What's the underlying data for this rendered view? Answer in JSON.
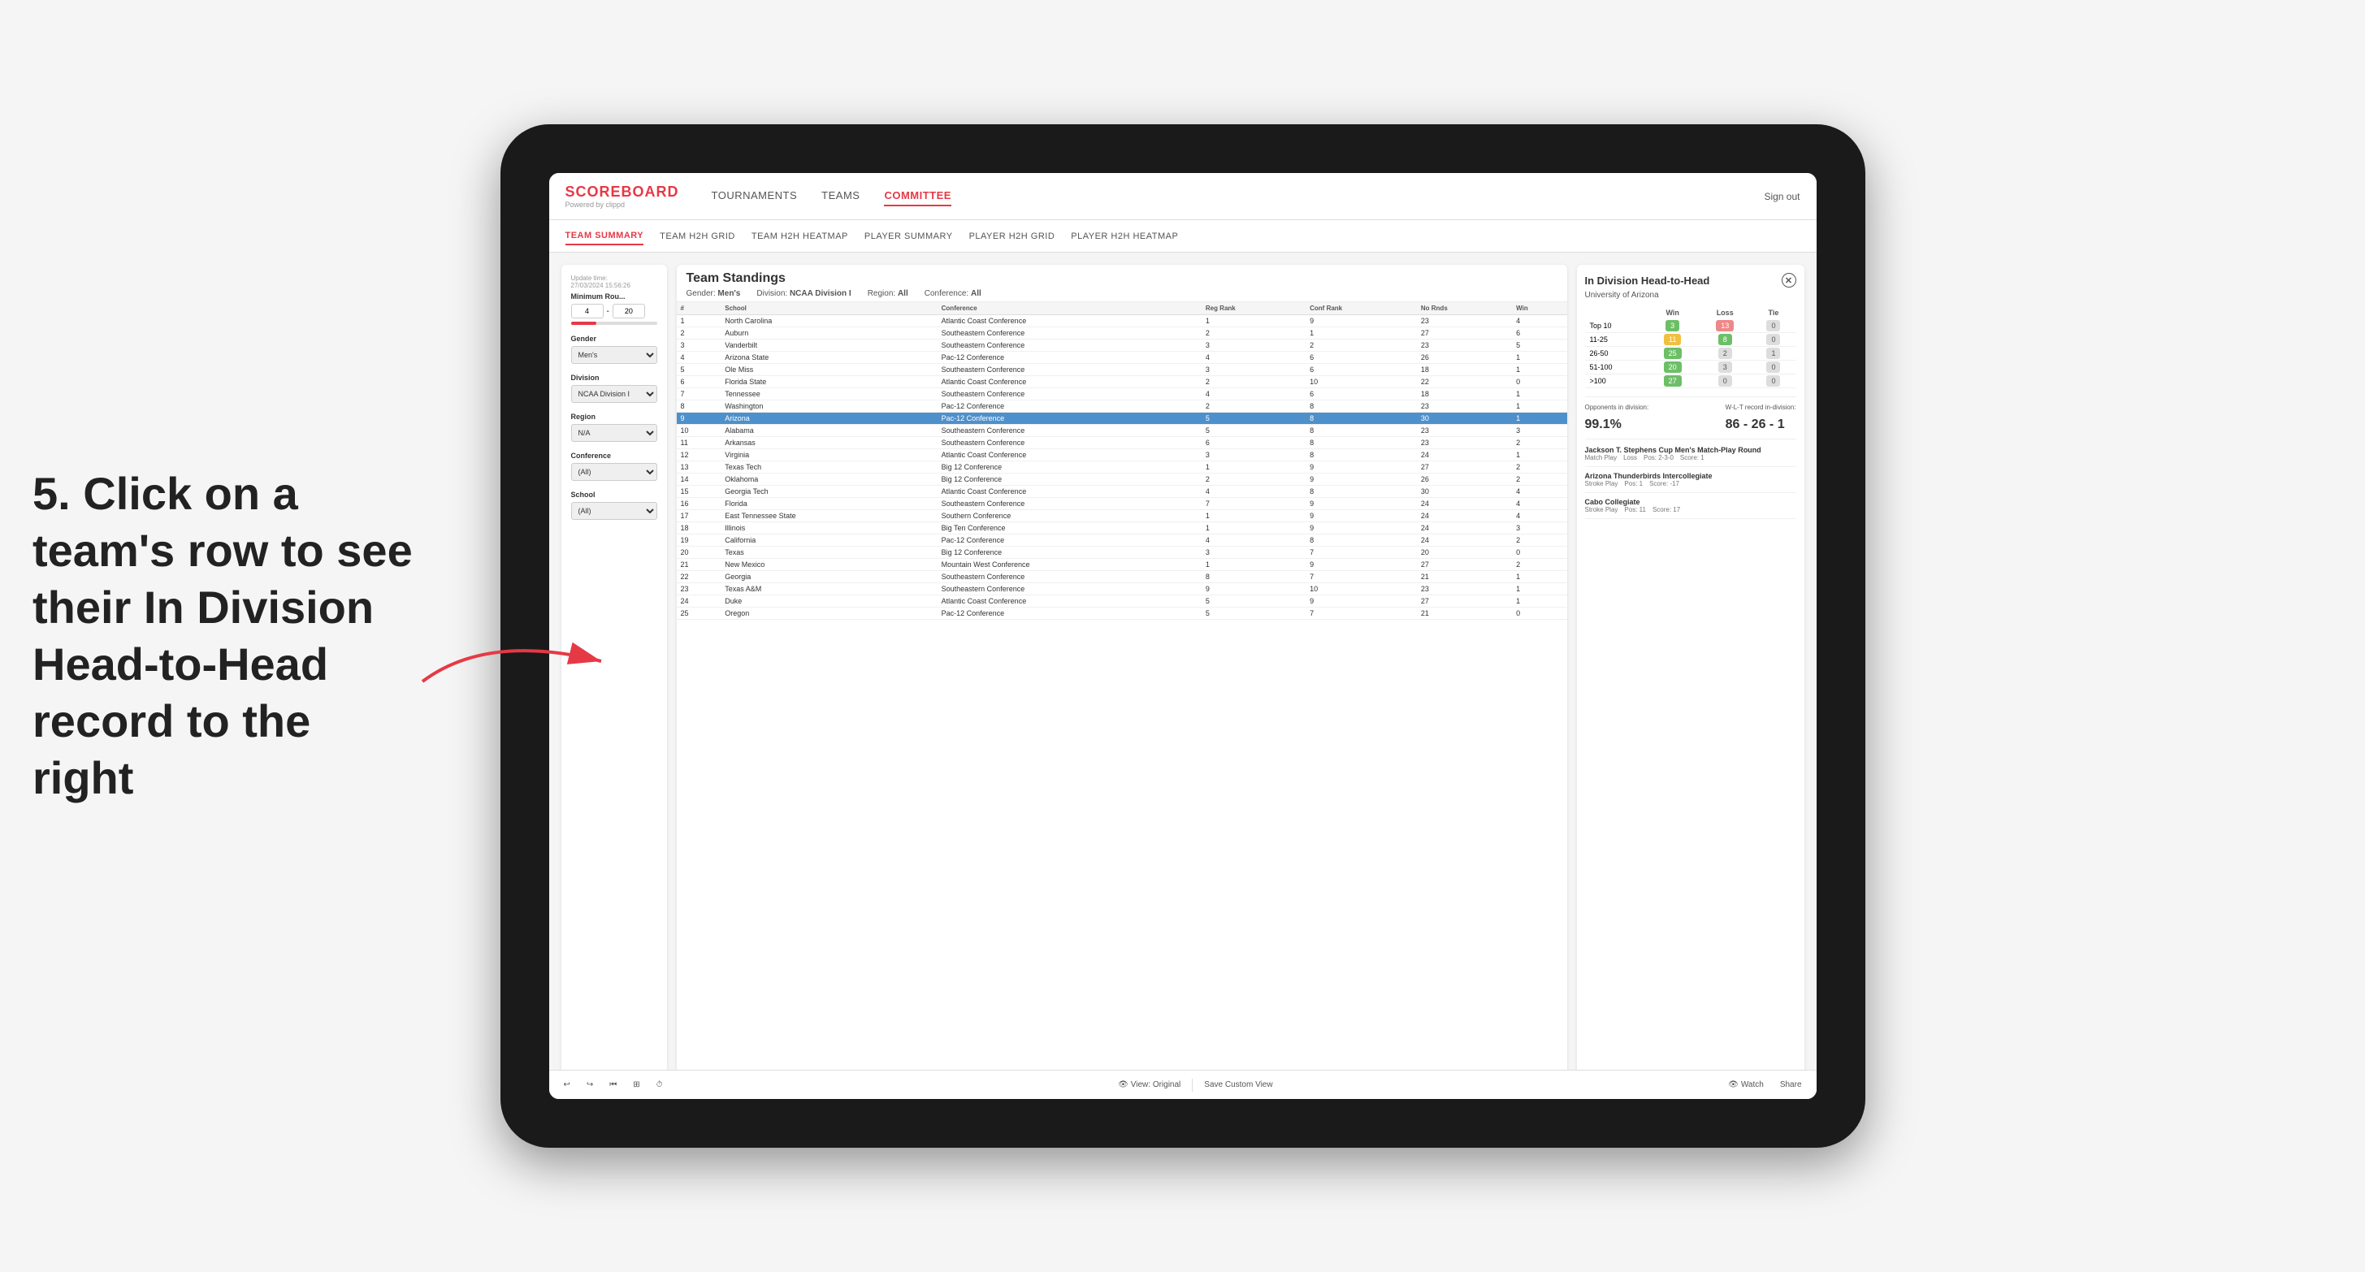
{
  "annotation": {
    "text": "5. Click on a team's row to see their In Division Head-to-Head record to the right"
  },
  "nav": {
    "logo": "SCOREBOARD",
    "logo_sub": "Powered by clippd",
    "items": [
      "TOURNAMENTS",
      "TEAMS",
      "COMMITTEE"
    ],
    "active_item": "COMMITTEE",
    "sign_out": "Sign out"
  },
  "sub_nav": {
    "items": [
      "TEAM SUMMARY",
      "TEAM H2H GRID",
      "TEAM H2H HEATMAP",
      "PLAYER SUMMARY",
      "PLAYER H2H GRID",
      "PLAYER H2H HEATMAP"
    ],
    "active_item": "PLAYER SUMMARY"
  },
  "filters": {
    "update_time_label": "Update time:",
    "update_time": "27/03/2024 15:56:26",
    "min_rounds_label": "Minimum Rou...",
    "min_rounds_min": "4",
    "min_rounds_max": "20",
    "gender_label": "Gender",
    "gender_value": "Men's",
    "division_label": "Division",
    "division_value": "NCAA Division I",
    "region_label": "Region",
    "region_value": "N/A",
    "conference_label": "Conference",
    "conference_value": "(All)",
    "school_label": "School",
    "school_value": "(All)"
  },
  "standings": {
    "title": "Team Standings",
    "gender": "Men's",
    "division": "NCAA Division I",
    "region": "All",
    "conference": "All",
    "columns": [
      "#",
      "School",
      "Conference",
      "Reg Rank",
      "Conf Rank",
      "No Rnds",
      "Win"
    ],
    "rows": [
      {
        "num": 1,
        "school": "North Carolina",
        "conference": "Atlantic Coast Conference",
        "reg_rank": 1,
        "conf_rank": 9,
        "no_rnds": 23,
        "win": 4
      },
      {
        "num": 2,
        "school": "Auburn",
        "conference": "Southeastern Conference",
        "reg_rank": 2,
        "conf_rank": 1,
        "no_rnds": 27,
        "win": 6
      },
      {
        "num": 3,
        "school": "Vanderbilt",
        "conference": "Southeastern Conference",
        "reg_rank": 3,
        "conf_rank": 2,
        "no_rnds": 23,
        "win": 5
      },
      {
        "num": 4,
        "school": "Arizona State",
        "conference": "Pac-12 Conference",
        "reg_rank": 4,
        "conf_rank": 6,
        "no_rnds": 26,
        "win": 1
      },
      {
        "num": 5,
        "school": "Ole Miss",
        "conference": "Southeastern Conference",
        "reg_rank": 3,
        "conf_rank": 6,
        "no_rnds": 18,
        "win": 1
      },
      {
        "num": 6,
        "school": "Florida State",
        "conference": "Atlantic Coast Conference",
        "reg_rank": 2,
        "conf_rank": 10,
        "no_rnds": 22,
        "win": 0
      },
      {
        "num": 7,
        "school": "Tennessee",
        "conference": "Southeastern Conference",
        "reg_rank": 4,
        "conf_rank": 6,
        "no_rnds": 18,
        "win": 1
      },
      {
        "num": 8,
        "school": "Washington",
        "conference": "Pac-12 Conference",
        "reg_rank": 2,
        "conf_rank": 8,
        "no_rnds": 23,
        "win": 1
      },
      {
        "num": 9,
        "school": "Arizona",
        "conference": "Pac-12 Conference",
        "reg_rank": 5,
        "conf_rank": 8,
        "no_rnds": 30,
        "win": 1,
        "highlighted": true
      },
      {
        "num": 10,
        "school": "Alabama",
        "conference": "Southeastern Conference",
        "reg_rank": 5,
        "conf_rank": 8,
        "no_rnds": 23,
        "win": 3
      },
      {
        "num": 11,
        "school": "Arkansas",
        "conference": "Southeastern Conference",
        "reg_rank": 6,
        "conf_rank": 8,
        "no_rnds": 23,
        "win": 2
      },
      {
        "num": 12,
        "school": "Virginia",
        "conference": "Atlantic Coast Conference",
        "reg_rank": 3,
        "conf_rank": 8,
        "no_rnds": 24,
        "win": 1
      },
      {
        "num": 13,
        "school": "Texas Tech",
        "conference": "Big 12 Conference",
        "reg_rank": 1,
        "conf_rank": 9,
        "no_rnds": 27,
        "win": 2
      },
      {
        "num": 14,
        "school": "Oklahoma",
        "conference": "Big 12 Conference",
        "reg_rank": 2,
        "conf_rank": 9,
        "no_rnds": 26,
        "win": 2
      },
      {
        "num": 15,
        "school": "Georgia Tech",
        "conference": "Atlantic Coast Conference",
        "reg_rank": 4,
        "conf_rank": 8,
        "no_rnds": 30,
        "win": 4
      },
      {
        "num": 16,
        "school": "Florida",
        "conference": "Southeastern Conference",
        "reg_rank": 7,
        "conf_rank": 9,
        "no_rnds": 24,
        "win": 4
      },
      {
        "num": 17,
        "school": "East Tennessee State",
        "conference": "Southern Conference",
        "reg_rank": 1,
        "conf_rank": 9,
        "no_rnds": 24,
        "win": 4
      },
      {
        "num": 18,
        "school": "Illinois",
        "conference": "Big Ten Conference",
        "reg_rank": 1,
        "conf_rank": 9,
        "no_rnds": 24,
        "win": 3
      },
      {
        "num": 19,
        "school": "California",
        "conference": "Pac-12 Conference",
        "reg_rank": 4,
        "conf_rank": 8,
        "no_rnds": 24,
        "win": 2
      },
      {
        "num": 20,
        "school": "Texas",
        "conference": "Big 12 Conference",
        "reg_rank": 3,
        "conf_rank": 7,
        "no_rnds": 20,
        "win": 0
      },
      {
        "num": 21,
        "school": "New Mexico",
        "conference": "Mountain West Conference",
        "reg_rank": 1,
        "conf_rank": 9,
        "no_rnds": 27,
        "win": 2
      },
      {
        "num": 22,
        "school": "Georgia",
        "conference": "Southeastern Conference",
        "reg_rank": 8,
        "conf_rank": 7,
        "no_rnds": 21,
        "win": 1
      },
      {
        "num": 23,
        "school": "Texas A&M",
        "conference": "Southeastern Conference",
        "reg_rank": 9,
        "conf_rank": 10,
        "no_rnds": 23,
        "win": 1
      },
      {
        "num": 24,
        "school": "Duke",
        "conference": "Atlantic Coast Conference",
        "reg_rank": 5,
        "conf_rank": 9,
        "no_rnds": 27,
        "win": 1
      },
      {
        "num": 25,
        "school": "Oregon",
        "conference": "Pac-12 Conference",
        "reg_rank": 5,
        "conf_rank": 7,
        "no_rnds": 21,
        "win": 0
      }
    ]
  },
  "h2h": {
    "title": "In Division Head-to-Head",
    "school": "University of Arizona",
    "win_label": "Win",
    "loss_label": "Loss",
    "tie_label": "Tie",
    "rows": [
      {
        "range": "Top 10",
        "win": 3,
        "loss": 13,
        "tie": 0,
        "win_color": "green",
        "loss_color": "red",
        "tie_color": "gray"
      },
      {
        "range": "11-25",
        "win": 11,
        "loss": 8,
        "tie": 0,
        "win_color": "yellow",
        "loss_color": "green",
        "tie_color": "gray"
      },
      {
        "range": "26-50",
        "win": 25,
        "loss": 2,
        "tie": 1,
        "win_color": "green",
        "loss_color": "gray",
        "tie_color": "gray"
      },
      {
        "range": "51-100",
        "win": 20,
        "loss": 3,
        "tie": 0,
        "win_color": "green",
        "loss_color": "gray",
        "tie_color": "gray"
      },
      {
        "range": ">100",
        "win": 27,
        "loss": 0,
        "tie": 0,
        "win_color": "green",
        "loss_color": "gray",
        "tie_color": "gray"
      }
    ],
    "opponents_label": "Opponents in division:",
    "opponents_pct": "99.1%",
    "wlt_label": "W-L-T record in-division:",
    "wlt_record": "86 - 26 - 1",
    "tournaments": [
      {
        "name": "Jackson T. Stephens Cup Men's Match-Play Round",
        "event_type": "Match Play",
        "result": "Loss",
        "pos": "2-3-0",
        "score": "1"
      },
      {
        "name": "Arizona Thunderbirds Intercollegiate",
        "event_type": "Stroke Play",
        "result": "",
        "pos": "1",
        "score": "-17"
      },
      {
        "name": "Cabo Collegiate",
        "event_type": "Stroke Play",
        "result": "",
        "pos": "11",
        "score": "17"
      }
    ]
  },
  "toolbar": {
    "undo": "↩",
    "redo": "↪",
    "step_back": "⏮",
    "options": "⚙",
    "clock": "🕐",
    "view_original": "View: Original",
    "save_custom": "Save Custom View",
    "watch": "Watch",
    "share": "Share"
  }
}
